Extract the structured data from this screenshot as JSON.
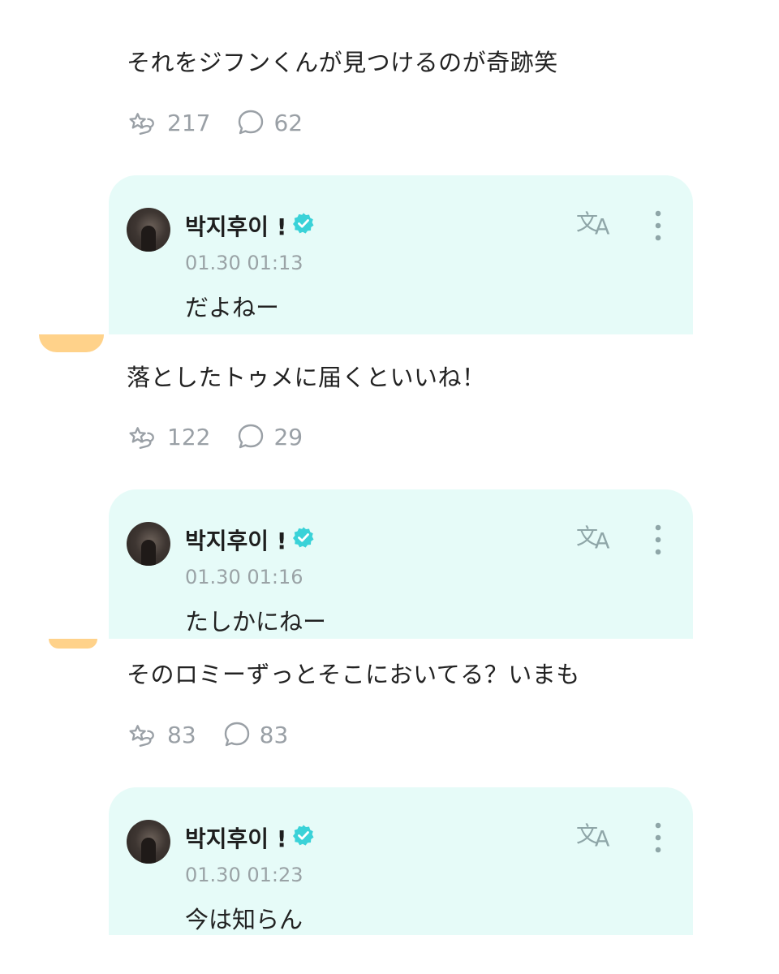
{
  "colors": {
    "reply_bg": "#e6fbf8",
    "verified": "#3ad2d8",
    "stat_gray": "#9aa0a6",
    "avatar_peek": "#ffd28a"
  },
  "icons": {
    "like": "star-hand-icon",
    "comment": "speech-bubble-icon",
    "translate": "translate-icon",
    "more": "more-vertical-icon",
    "verified": "verified-badge-icon"
  },
  "posts": [
    {
      "text": "それをジフンくんが見つけるのが奇跡笑",
      "likes": "217",
      "comments": "62",
      "reply": {
        "author": "박지후이 !",
        "time": "01.30 01:13",
        "text": "だよねー"
      }
    },
    {
      "text": "落としたトゥメに届くといいね！",
      "likes": "122",
      "comments": "29",
      "reply": {
        "author": "박지후이 !",
        "time": "01.30 01:16",
        "text": "たしかにねー"
      }
    },
    {
      "text": "そのロミーずっとそこにおいてる？いまも",
      "likes": "83",
      "comments": "83",
      "reply": {
        "author": "박지후이 !",
        "time": "01.30 01:23",
        "text": "今は知らん"
      }
    }
  ]
}
